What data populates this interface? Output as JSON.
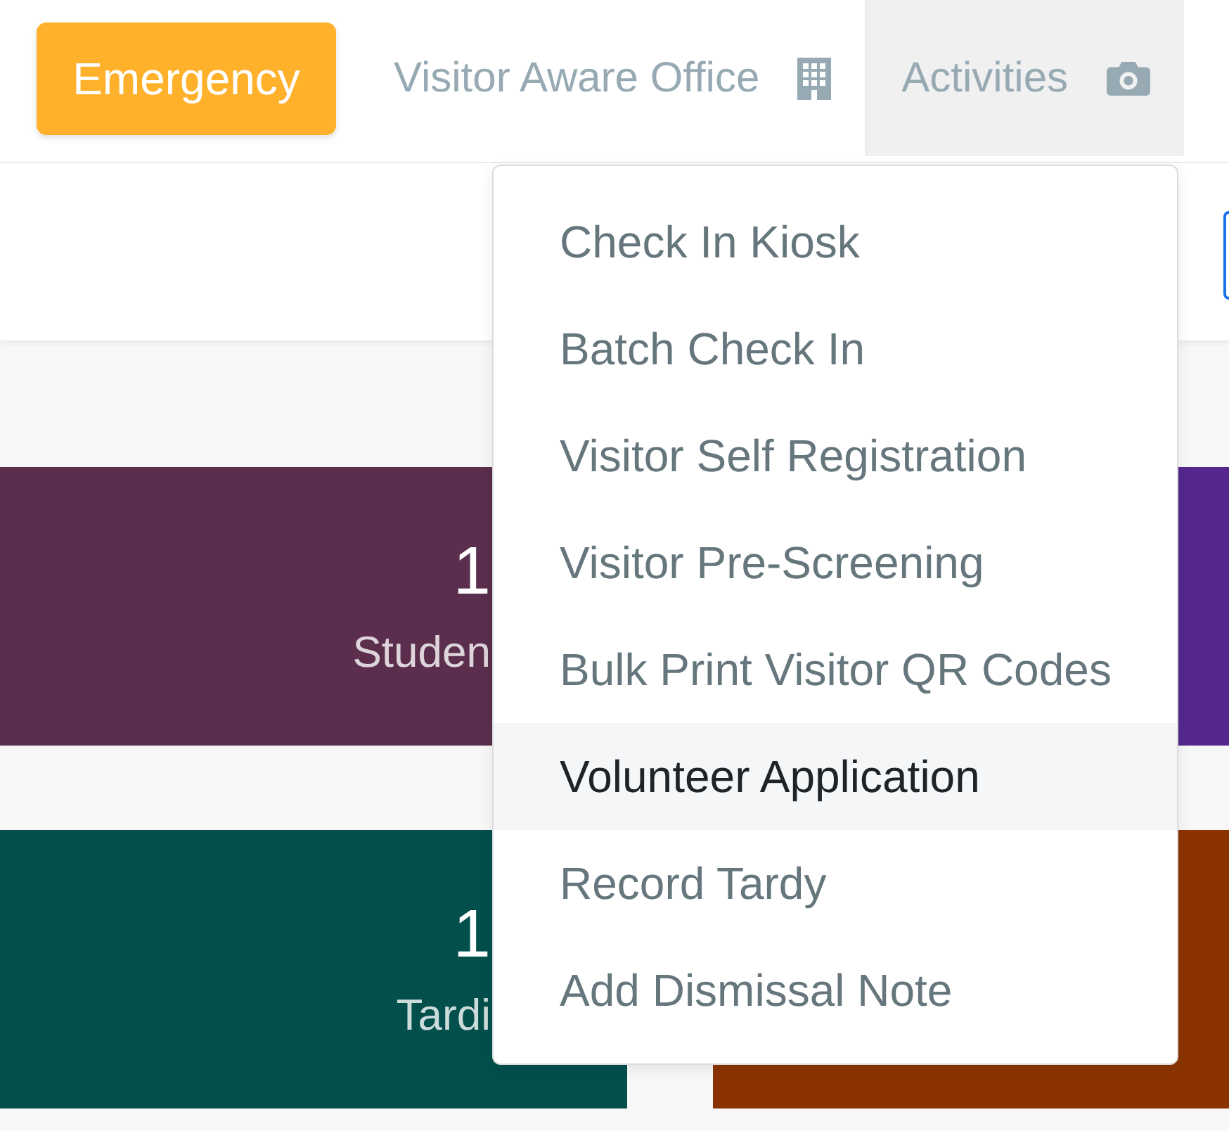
{
  "header": {
    "emergency_button": "Emergency",
    "nav": [
      {
        "label": "Visitor Aware Office",
        "selected": false
      },
      {
        "label": "Activities",
        "selected": true
      }
    ]
  },
  "activities_menu": {
    "items": [
      {
        "label": "Check In Kiosk",
        "selected": false
      },
      {
        "label": "Batch Check In",
        "selected": false
      },
      {
        "label": "Visitor Self Registration",
        "selected": false
      },
      {
        "label": "Visitor Pre-Screening",
        "selected": false
      },
      {
        "label": "Bulk Print Visitor QR Codes",
        "selected": false
      },
      {
        "label": "Volunteer Application",
        "selected": true
      },
      {
        "label": "Record Tardy",
        "selected": false
      },
      {
        "label": "Add Dismissal Note",
        "selected": false
      }
    ]
  },
  "stat_cards": [
    {
      "value": "1",
      "label": "Studen",
      "color": "#5a2e4c"
    },
    {
      "color": "#54288d"
    },
    {
      "value": "1",
      "label": "Tardi",
      "color": "#034f4c"
    },
    {
      "color": "#8b3300"
    }
  ]
}
